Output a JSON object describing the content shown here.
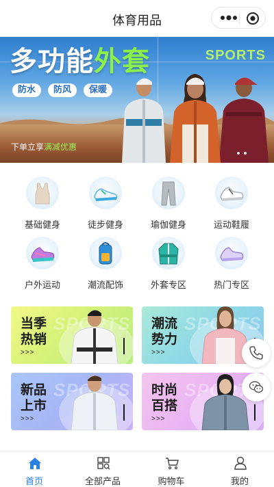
{
  "header": {
    "title": "体育用品",
    "more_icon": "more-dots-icon",
    "close_icon": "target-close-icon"
  },
  "banner": {
    "headline_white": "多功能",
    "headline_green": "外套",
    "sports": "SPORTS",
    "pills": [
      "防水",
      "防风",
      "保暖"
    ],
    "promo_prefix": "下单立享",
    "promo_highlight": "满减优惠",
    "accent_green": "#8cf04a"
  },
  "categories": [
    {
      "label": "基础健身",
      "icon": "tank-top-icon"
    },
    {
      "label": "徒步健身",
      "icon": "hiking-shoe-icon"
    },
    {
      "label": "瑜伽健身",
      "icon": "yoga-pants-icon"
    },
    {
      "label": "运动鞋履",
      "icon": "sneaker-icon"
    },
    {
      "label": "户外运动",
      "icon": "running-shoe-icon"
    },
    {
      "label": "潮流配饰",
      "icon": "backpack-icon"
    },
    {
      "label": "外套专区",
      "icon": "jacket-icon"
    },
    {
      "label": "热门专区",
      "icon": "purple-shoe-icon"
    }
  ],
  "cards": [
    {
      "title": "当季热销",
      "arrows": ">>>",
      "watermark": "SPORTS"
    },
    {
      "title": "潮流势力",
      "arrows": ">>>",
      "watermark": "SPORTS"
    },
    {
      "title": "新品上市",
      "arrows": ">>>",
      "watermark": "SPORTS"
    },
    {
      "title": "时尚百搭",
      "arrows": ">>>",
      "watermark": "SPORTS"
    }
  ],
  "floating": {
    "phone_icon": "phone-icon",
    "chat_icon": "wechat-chat-icon"
  },
  "tabbar": {
    "items": [
      {
        "label": "首页",
        "icon": "home-icon",
        "active": true
      },
      {
        "label": "全部产品",
        "icon": "grid-icon",
        "active": false
      },
      {
        "label": "购物车",
        "icon": "cart-icon",
        "active": false
      },
      {
        "label": "我的",
        "icon": "user-icon",
        "active": false
      }
    ],
    "active_color": "#2a82e4"
  }
}
